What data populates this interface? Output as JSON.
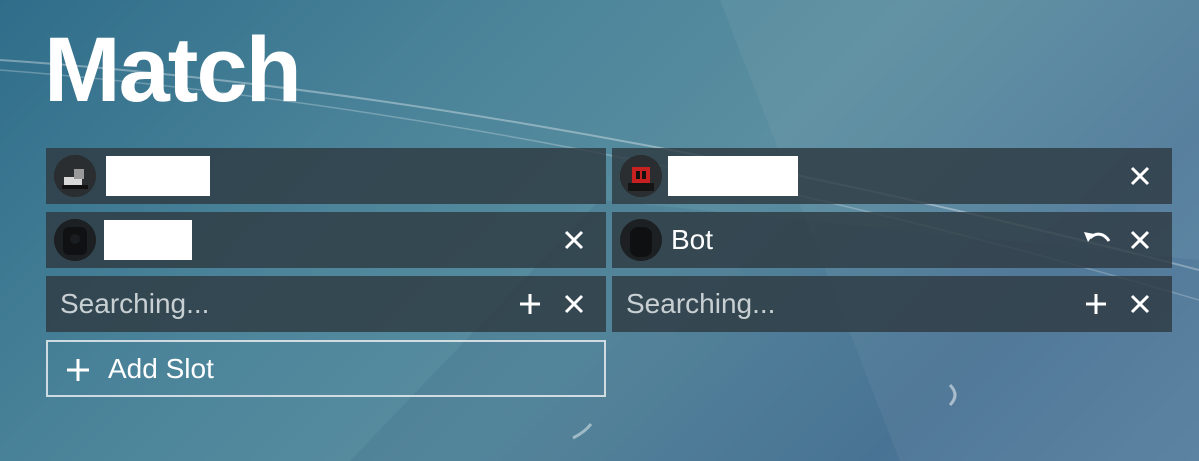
{
  "page": {
    "title": "Match"
  },
  "slots": {
    "left": [
      {
        "type": "player",
        "name": "",
        "avatar": "player-avatar-icon",
        "actions": []
      },
      {
        "type": "player",
        "name": "",
        "avatar": "player-avatar-icon",
        "actions": [
          "remove"
        ]
      },
      {
        "type": "searching",
        "text": "Searching...",
        "actions": [
          "add",
          "remove"
        ]
      }
    ],
    "right": [
      {
        "type": "player",
        "name": "",
        "avatar": "player-avatar-icon",
        "actions": [
          "remove"
        ]
      },
      {
        "type": "bot",
        "name": "Bot",
        "avatar": "bot-avatar-icon",
        "actions": [
          "undo",
          "remove"
        ]
      },
      {
        "type": "searching",
        "text": "Searching...",
        "actions": [
          "add",
          "remove"
        ]
      }
    ]
  },
  "add_slot": {
    "label": "Add Slot",
    "icon": "plus-icon"
  },
  "colors": {
    "slot_bg": "#2e3a42",
    "text": "#ffffff",
    "muted_text": "#c9d0d3",
    "redaction": "#ffffff"
  }
}
